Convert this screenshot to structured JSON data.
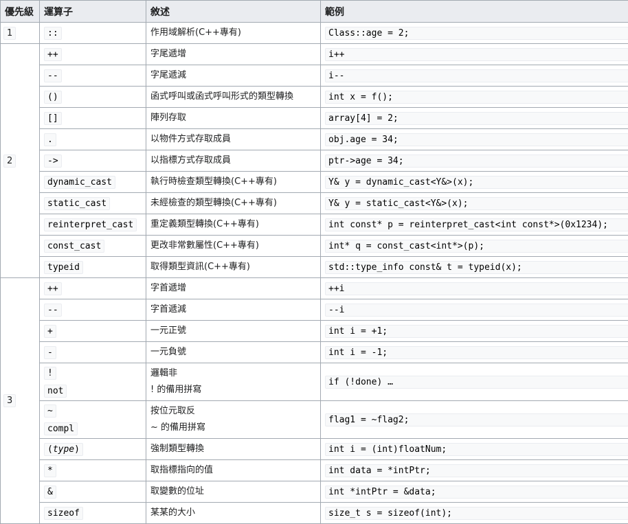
{
  "headers": [
    "優先級",
    "運算子",
    "敘述",
    "範例"
  ],
  "groups": [
    {
      "precedence": "1",
      "rows": [
        {
          "ops": [
            "::"
          ],
          "desc": [
            "作用域解析(C++專有)"
          ],
          "example": "Class::age = 2;"
        }
      ]
    },
    {
      "precedence": "2",
      "rows": [
        {
          "ops": [
            "++"
          ],
          "desc": [
            "字尾遞增"
          ],
          "example": "i++"
        },
        {
          "ops": [
            "--"
          ],
          "desc": [
            "字尾遞減"
          ],
          "example": "i--"
        },
        {
          "ops": [
            "()"
          ],
          "desc": [
            "函式呼叫或函式呼叫形式的類型轉換"
          ],
          "example": "int x = f();"
        },
        {
          "ops": [
            "[]"
          ],
          "desc": [
            "陣列存取"
          ],
          "example": "array[4] = 2;"
        },
        {
          "ops": [
            "."
          ],
          "desc": [
            "以物件方式存取成員"
          ],
          "example": "obj.age = 34;"
        },
        {
          "ops": [
            "->"
          ],
          "desc": [
            "以指標方式存取成員"
          ],
          "example": "ptr->age = 34;"
        },
        {
          "ops": [
            "dynamic_cast"
          ],
          "desc": [
            "執行時檢查類型轉換(C++專有)"
          ],
          "example": "Y& y = dynamic_cast<Y&>(x);"
        },
        {
          "ops": [
            "static_cast"
          ],
          "desc": [
            "未經檢查的類型轉換(C++專有)"
          ],
          "example": "Y& y = static_cast<Y&>(x);"
        },
        {
          "ops": [
            "reinterpret_cast"
          ],
          "desc": [
            "重定義類型轉換(C++專有)"
          ],
          "example": "int const* p = reinterpret_cast<int const*>(0x1234);"
        },
        {
          "ops": [
            "const_cast"
          ],
          "desc": [
            "更改非常數屬性(C++專有)"
          ],
          "example": "int* q = const_cast<int*>(p);"
        },
        {
          "ops": [
            "typeid"
          ],
          "desc": [
            "取得類型資訊(C++專有)"
          ],
          "example": "std::type_info const& t = typeid(x);"
        }
      ]
    },
    {
      "precedence": "3",
      "rows": [
        {
          "ops": [
            "++"
          ],
          "desc": [
            "字首遞增"
          ],
          "example": "++i"
        },
        {
          "ops": [
            "--"
          ],
          "desc": [
            "字首遞減"
          ],
          "example": "--i"
        },
        {
          "ops": [
            "+"
          ],
          "desc": [
            "一元正號"
          ],
          "example": "int i = +1;"
        },
        {
          "ops": [
            "-"
          ],
          "desc": [
            "一元負號"
          ],
          "example": "int i = -1;"
        },
        {
          "ops": [
            "!",
            "not"
          ],
          "desc": [
            "邏輯非",
            "! 的備用拼寫"
          ],
          "example": "if (!done) …"
        },
        {
          "ops": [
            "~",
            "compl"
          ],
          "desc": [
            "按位元取反",
            "~ 的備用拼寫"
          ],
          "example": "flag1 = ~flag2;"
        },
        {
          "ops": [
            "(type)"
          ],
          "desc": [
            "強制類型轉換"
          ],
          "example": "int i = (int)floatNum;"
        },
        {
          "ops": [
            "*"
          ],
          "desc": [
            "取指標指向的值"
          ],
          "example": "int data = *intPtr;"
        },
        {
          "ops": [
            "&"
          ],
          "desc": [
            "取變數的位址"
          ],
          "example": "int *intPtr = &data;"
        },
        {
          "ops": [
            "sizeof"
          ],
          "desc": [
            "某某的大小"
          ],
          "example": "size_t s = sizeof(int);"
        }
      ]
    }
  ]
}
